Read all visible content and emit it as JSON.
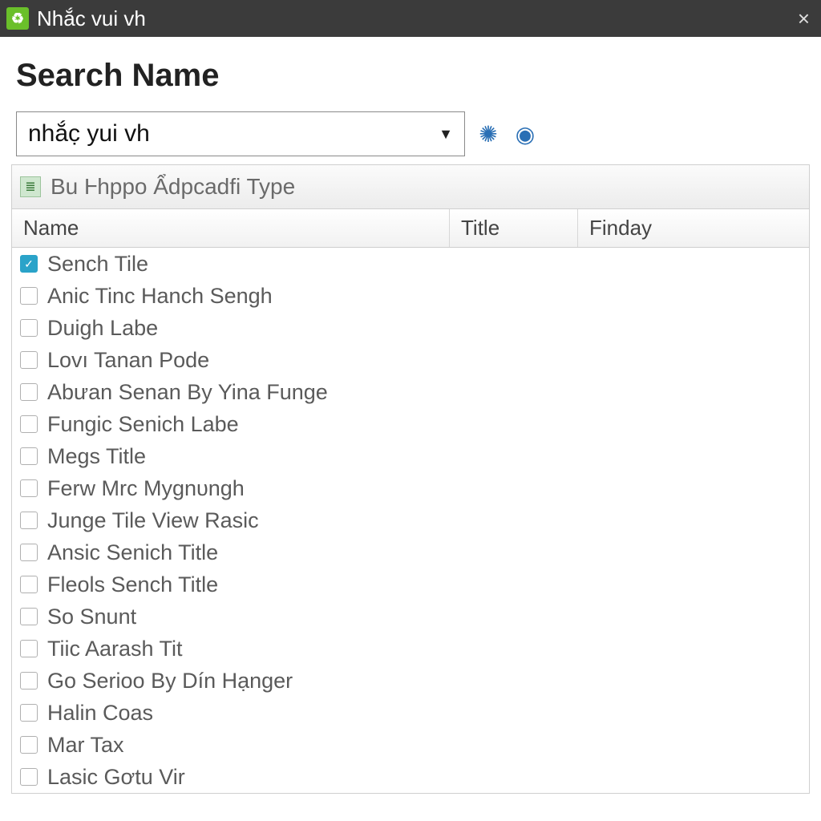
{
  "window": {
    "title": "Nhắc vui vh"
  },
  "heading": "Search Name",
  "search": {
    "value": "nhắc̣ yui vh"
  },
  "toolbar": {
    "label": "Bu Ⱶhppo Ẩdpcadfi Type"
  },
  "columns": {
    "name": "Name",
    "title": "Title",
    "finday": "Finday"
  },
  "rows": [
    {
      "checked": true,
      "name": "Sench Tile"
    },
    {
      "checked": false,
      "name": "Anic Tinc Hanch Sengh"
    },
    {
      "checked": false,
      "name": "Duigh Labe"
    },
    {
      "checked": false,
      "name": "Lovı Tanan Pode"
    },
    {
      "checked": false,
      "name": "Abưan Senan By Yina Funge"
    },
    {
      "checked": false,
      "name": "Fungic Senich Labe"
    },
    {
      "checked": false,
      "name": "Megs Title"
    },
    {
      "checked": false,
      "name": "Ferw Mrc Mygnυngh"
    },
    {
      "checked": false,
      "name": "Junge Tile View Rasic"
    },
    {
      "checked": false,
      "name": "Ansic Senich Title"
    },
    {
      "checked": false,
      "name": "Fleols Sench Title"
    },
    {
      "checked": false,
      "name": "So Snunt"
    },
    {
      "checked": false,
      "name": "Tiic Aarash Tit"
    },
    {
      "checked": false,
      "name": "Go Serioo By Dín Hạnger"
    },
    {
      "checked": false,
      "name": "Halin Coas"
    },
    {
      "checked": false,
      "name": "Mar Tax"
    },
    {
      "checked": false,
      "name": "Lasic Gơtu Vir"
    }
  ]
}
